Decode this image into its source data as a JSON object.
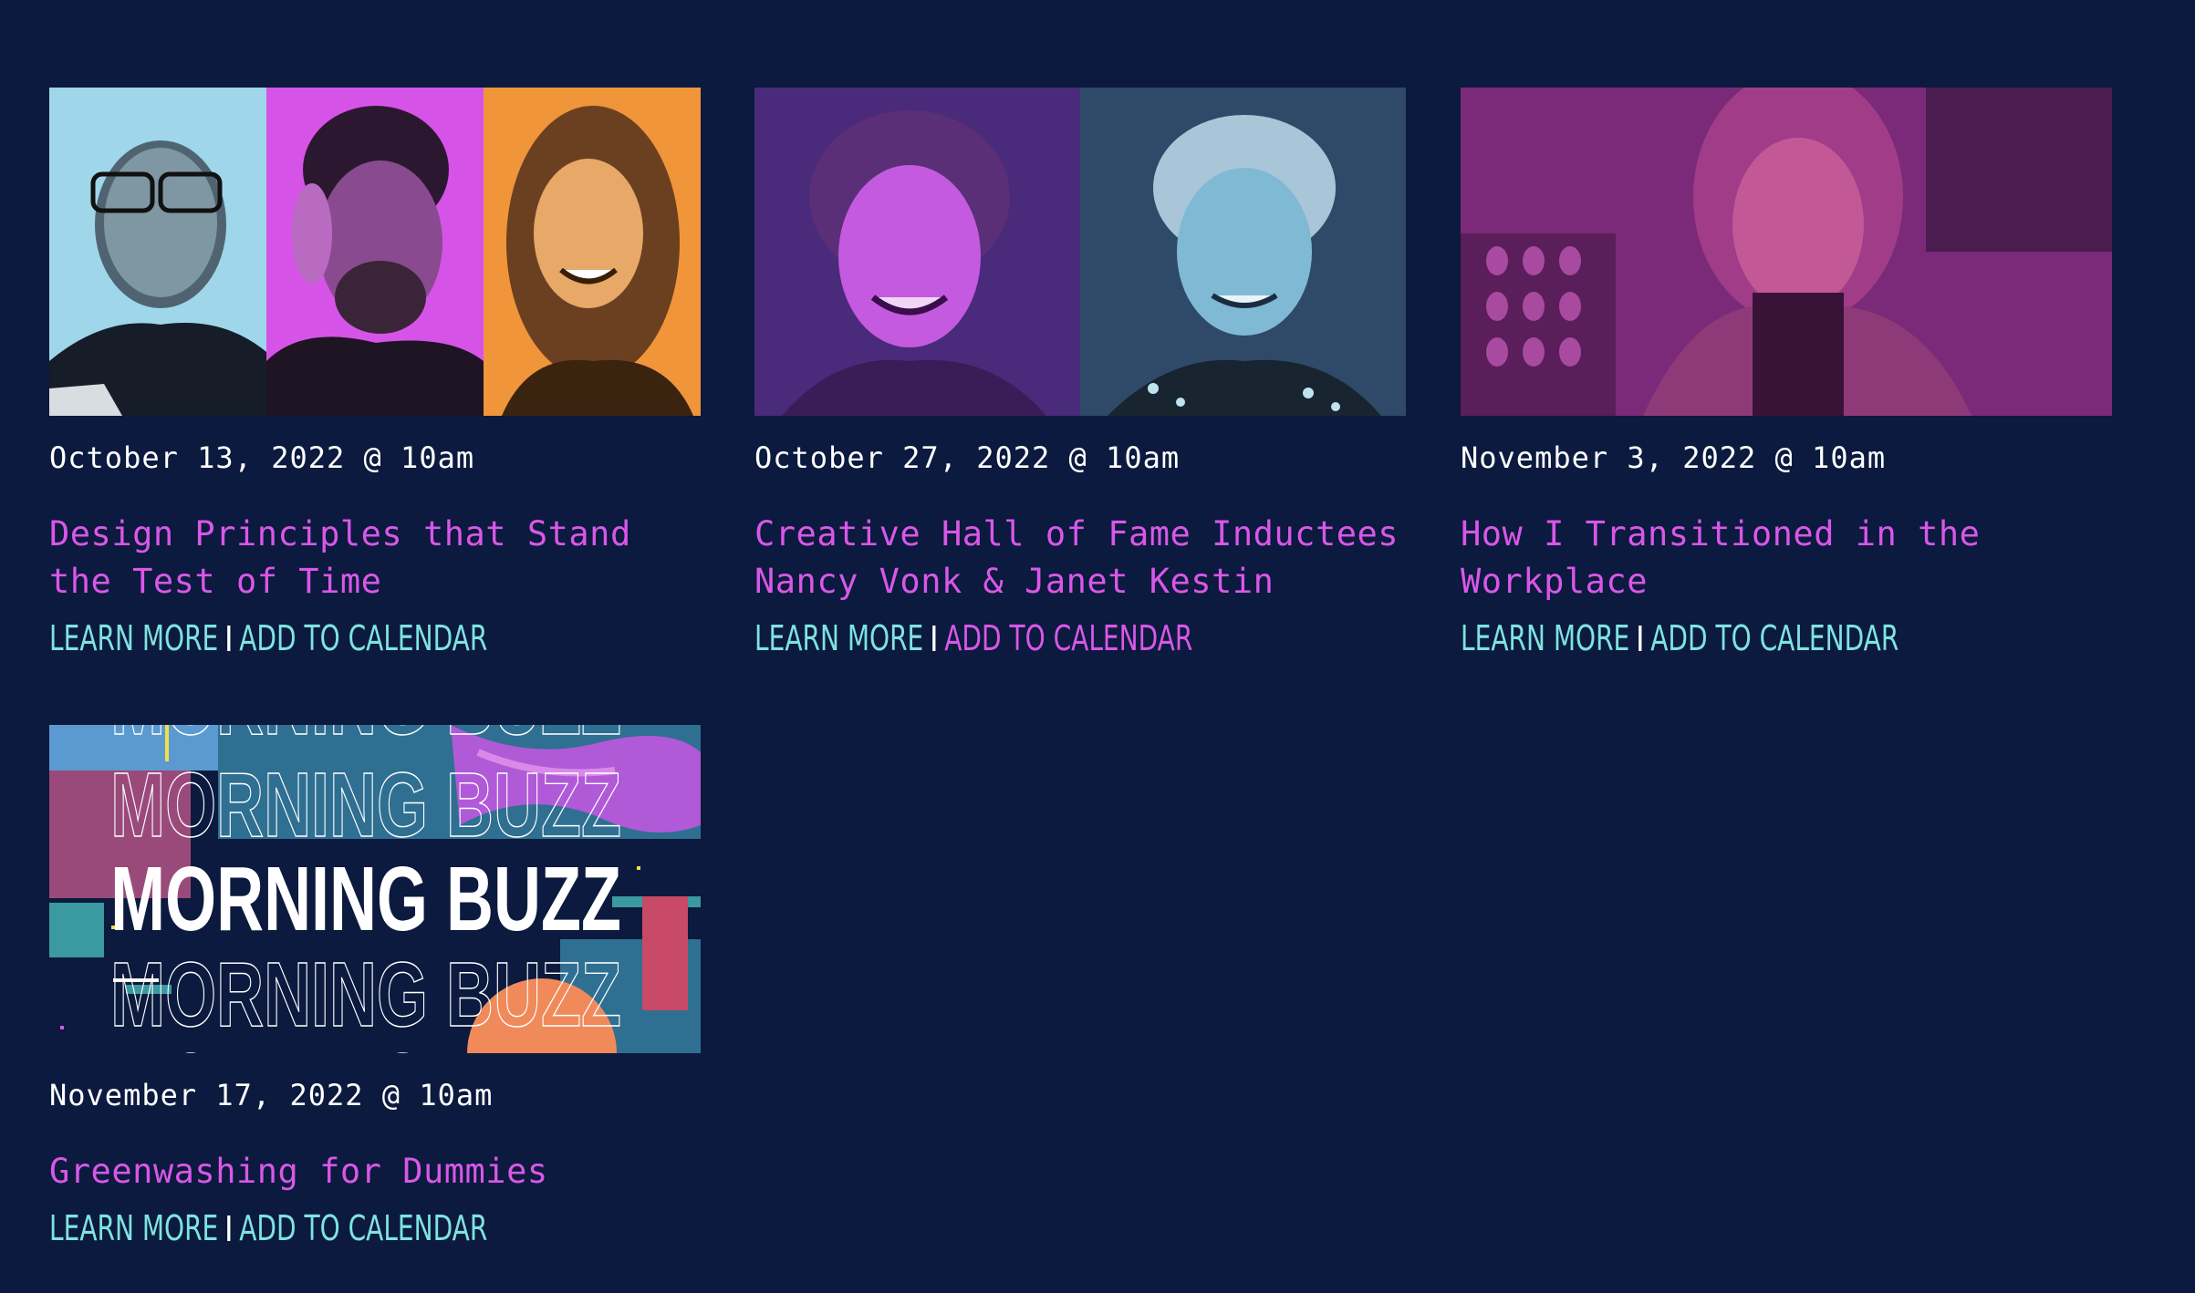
{
  "events": [
    {
      "date": "October 13, 2022 @ 10am",
      "title": "Design Principles that Stand the Test of Time",
      "learn_more": "LEARN MORE",
      "add_to_calendar": "ADD TO CALENDAR"
    },
    {
      "date": "October 27, 2022 @ 10am",
      "title": "Creative Hall of Fame Inductees Nancy Vonk & Janet Kestin",
      "learn_more": "LEARN MORE",
      "add_to_calendar": "ADD TO CALENDAR"
    },
    {
      "date": "November 3, 2022 @ 10am",
      "title": "How I Transitioned in the Workplace",
      "learn_more": "LEARN MORE",
      "add_to_calendar": "ADD TO CALENDAR"
    },
    {
      "date": "November 17, 2022 @ 10am",
      "title": "Greenwashing for Dummies",
      "learn_more": "LEARN MORE",
      "add_to_calendar": "ADD TO CALENDAR",
      "image_text": "MORNING BUZZ"
    }
  ],
  "colors": {
    "background": "#0b1a3e",
    "title": "#d957e8",
    "link": "#7fe3e0",
    "date": "#ffffff"
  }
}
